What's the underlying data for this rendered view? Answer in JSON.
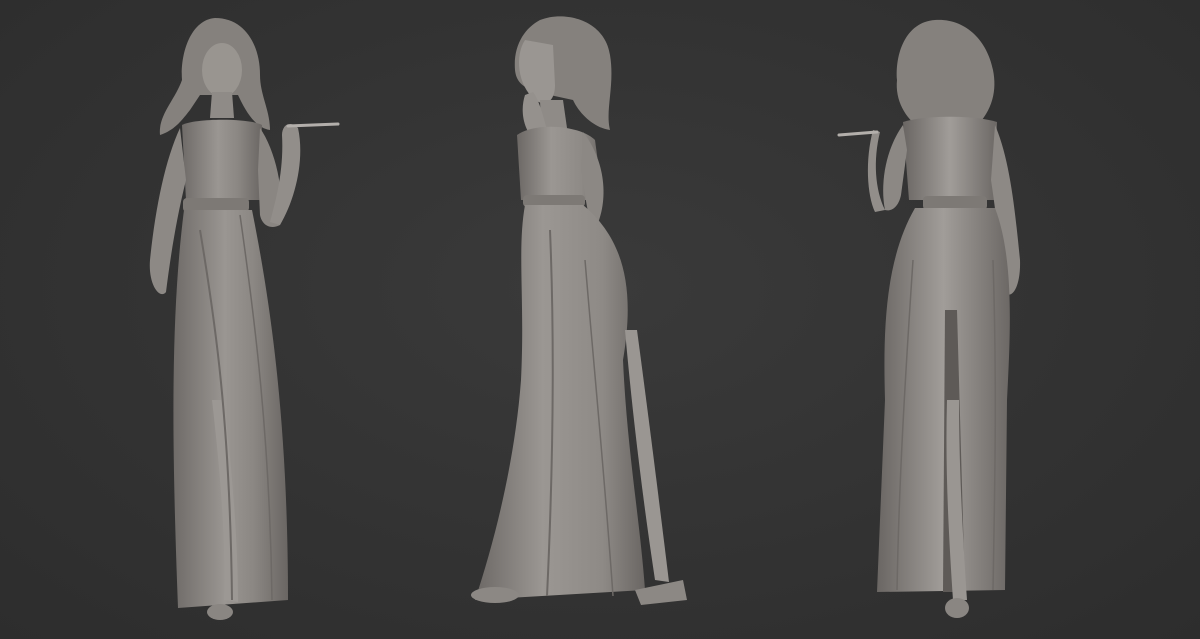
{
  "scene": {
    "background_color": "#343434",
    "material_color": "#8f8b87",
    "views": [
      {
        "view": "front",
        "icon": "sculpt-figure-front"
      },
      {
        "view": "side",
        "icon": "sculpt-figure-side"
      },
      {
        "view": "back",
        "icon": "sculpt-figure-back"
      }
    ]
  }
}
